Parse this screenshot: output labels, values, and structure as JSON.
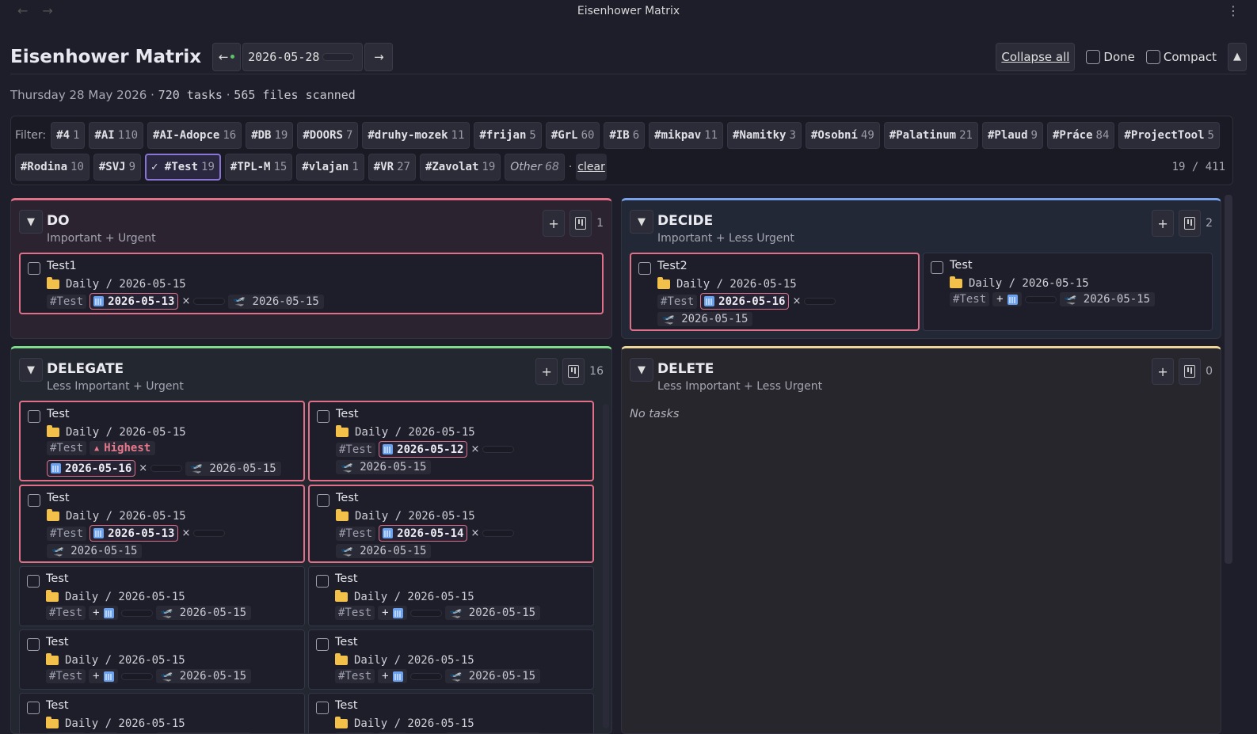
{
  "window": {
    "title": "Eisenhower Matrix"
  },
  "header": {
    "title": "Eisenhower Matrix",
    "prev_label": "←",
    "date": "2026-05-28",
    "next_label": "→",
    "collapse_label": "Collapse all",
    "done_label": "Done",
    "compact_label": "Compact",
    "up_label": "▲"
  },
  "summary": {
    "date_text": "Thursday 28 May 2026",
    "sep": "·",
    "tasks": "720 tasks",
    "files": "565 files scanned"
  },
  "filter": {
    "label": "Filter:",
    "row1": [
      {
        "tag": "#4",
        "count": "1"
      },
      {
        "tag": "#AI",
        "count": "110"
      },
      {
        "tag": "#AI-Adopce",
        "count": "16"
      },
      {
        "tag": "#DB",
        "count": "19"
      },
      {
        "tag": "#DOORS",
        "count": "7"
      },
      {
        "tag": "#druhy-mozek",
        "count": "11"
      },
      {
        "tag": "#frijan",
        "count": "5"
      },
      {
        "tag": "#GrL",
        "count": "60"
      },
      {
        "tag": "#IB",
        "count": "6"
      },
      {
        "tag": "#mikpav",
        "count": "11"
      },
      {
        "tag": "#Namitky",
        "count": "3"
      },
      {
        "tag": "#Osobní",
        "count": "49"
      },
      {
        "tag": "#Palatinum",
        "count": "21"
      },
      {
        "tag": "#Plaud",
        "count": "9"
      },
      {
        "tag": "#Práce",
        "count": "84"
      },
      {
        "tag": "#ProjectTool",
        "count": "5"
      }
    ],
    "row2": [
      {
        "tag": "#Rodina",
        "count": "10"
      },
      {
        "tag": "#SVJ",
        "count": "9"
      },
      {
        "tag": "✓ #Test",
        "count": "19",
        "active": true
      },
      {
        "tag": "#TPL-M",
        "count": "15"
      },
      {
        "tag": "#vlajan",
        "count": "1"
      },
      {
        "tag": "#VR",
        "count": "27"
      },
      {
        "tag": "#Zavolat",
        "count": "19"
      }
    ],
    "other": {
      "label": "Other",
      "count": "68"
    },
    "dot": "·",
    "clear_label": "clear",
    "count_text": "19 / 411"
  },
  "quadrants": {
    "do": {
      "title": "DO",
      "subtitle": "Important + Urgent",
      "count": "1",
      "add": "+"
    },
    "decide": {
      "title": "DECIDE",
      "subtitle": "Important + Less Urgent",
      "count": "2",
      "add": "+"
    },
    "delegate": {
      "title": "DELEGATE",
      "subtitle": "Less Important + Urgent",
      "count": "16",
      "add": "+"
    },
    "delete": {
      "title": "DELETE",
      "subtitle": "Less Important + Less Urgent",
      "count": "0",
      "add": "+",
      "empty": "No tasks"
    }
  },
  "tasks": {
    "path": "Daily / 2026-05-15",
    "tag": "#Test",
    "scheduled": "2026-05-15",
    "add": "+",
    "x": "×",
    "do": [
      {
        "name": "Test1",
        "due": "2026-05-13"
      }
    ],
    "decide": [
      {
        "name": "Test2",
        "due": "2026-05-16"
      },
      {
        "name": "Test"
      }
    ],
    "delegate": [
      {
        "name": "Test",
        "due": "2026-05-16",
        "priority": "Highest"
      },
      {
        "name": "Test",
        "due": "2026-05-12"
      },
      {
        "name": "Test",
        "due": "2026-05-13"
      },
      {
        "name": "Test",
        "due": "2026-05-14"
      },
      {
        "name": "Test"
      },
      {
        "name": "Test"
      },
      {
        "name": "Test"
      },
      {
        "name": "Test"
      },
      {
        "name": "Test"
      },
      {
        "name": "Test"
      }
    ]
  },
  "colors": {
    "do": "#e07288",
    "decide": "#7aa2e8",
    "delegate": "#7edc8a",
    "delete": "#efd79a",
    "active_filter": "#8a74d4"
  }
}
